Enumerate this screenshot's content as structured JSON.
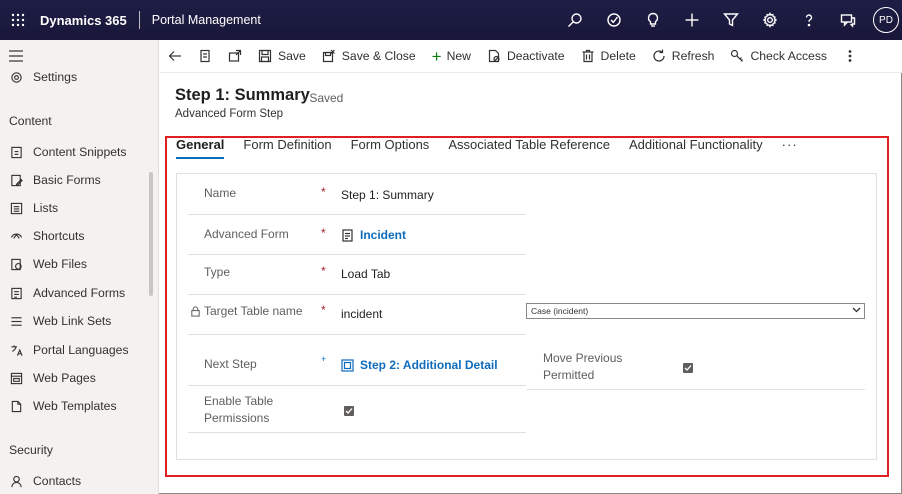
{
  "topbar": {
    "brand": "Dynamics 365",
    "app_name": "Portal Management",
    "avatar": "PD",
    "icons": [
      "search-icon",
      "target-icon",
      "lightbulb-icon",
      "plus-icon",
      "filter-icon",
      "gear-icon",
      "help-icon",
      "chat-icon"
    ]
  },
  "sidebar": {
    "settings_label": "Settings",
    "content_header": "Content",
    "items": [
      {
        "label": "Content Snippets",
        "icon": "snippet-icon"
      },
      {
        "label": "Basic Forms",
        "icon": "form-icon"
      },
      {
        "label": "Lists",
        "icon": "list-icon"
      },
      {
        "label": "Shortcuts",
        "icon": "shortcut-icon"
      },
      {
        "label": "Web Files",
        "icon": "file-icon"
      },
      {
        "label": "Advanced Forms",
        "icon": "advanced-form-icon"
      },
      {
        "label": "Web Link Sets",
        "icon": "link-set-icon"
      },
      {
        "label": "Portal Languages",
        "icon": "language-icon"
      },
      {
        "label": "Web Pages",
        "icon": "web-page-icon"
      },
      {
        "label": "Web Templates",
        "icon": "template-icon"
      }
    ],
    "security_header": "Security",
    "contacts_label": "Contacts"
  },
  "commandbar": {
    "save": "Save",
    "save_close": "Save & Close",
    "new": "New",
    "deactivate": "Deactivate",
    "delete": "Delete",
    "refresh": "Refresh",
    "check_access": "Check Access"
  },
  "record": {
    "title": "Step 1: Summary",
    "saved": "- Saved",
    "entity": "Advanced Form Step"
  },
  "tabs": [
    {
      "label": "General",
      "active": true
    },
    {
      "label": "Form Definition",
      "active": false
    },
    {
      "label": "Form Options",
      "active": false
    },
    {
      "label": "Associated Table Reference",
      "active": false
    },
    {
      "label": "Additional Functionality",
      "active": false
    }
  ],
  "tabs_more": "···",
  "form": {
    "name_label": "Name",
    "name_value": "Step 1: Summary",
    "advanced_form_label": "Advanced Form",
    "advanced_form_value": "Incident",
    "type_label": "Type",
    "type_value": "Load Tab",
    "target_table_label": "Target Table name",
    "target_table_value": "incident",
    "target_table_select": "Case (incident)",
    "next_step_label": "Next Step",
    "next_step_value": "Step 2: Additional Detail",
    "move_previous_label_1": "Move Previous",
    "move_previous_label_2": "Permitted",
    "move_previous_checked": true,
    "enable_perm_label_1": "Enable Table",
    "enable_perm_label_2": "Permissions",
    "enable_perm_checked": true,
    "required_mark": "*",
    "recommended_mark": "+"
  },
  "colors": {
    "topbar": "#1b1a40",
    "accent": "#0f6cbd",
    "required": "#a4262c",
    "highlight": "#e02020"
  }
}
